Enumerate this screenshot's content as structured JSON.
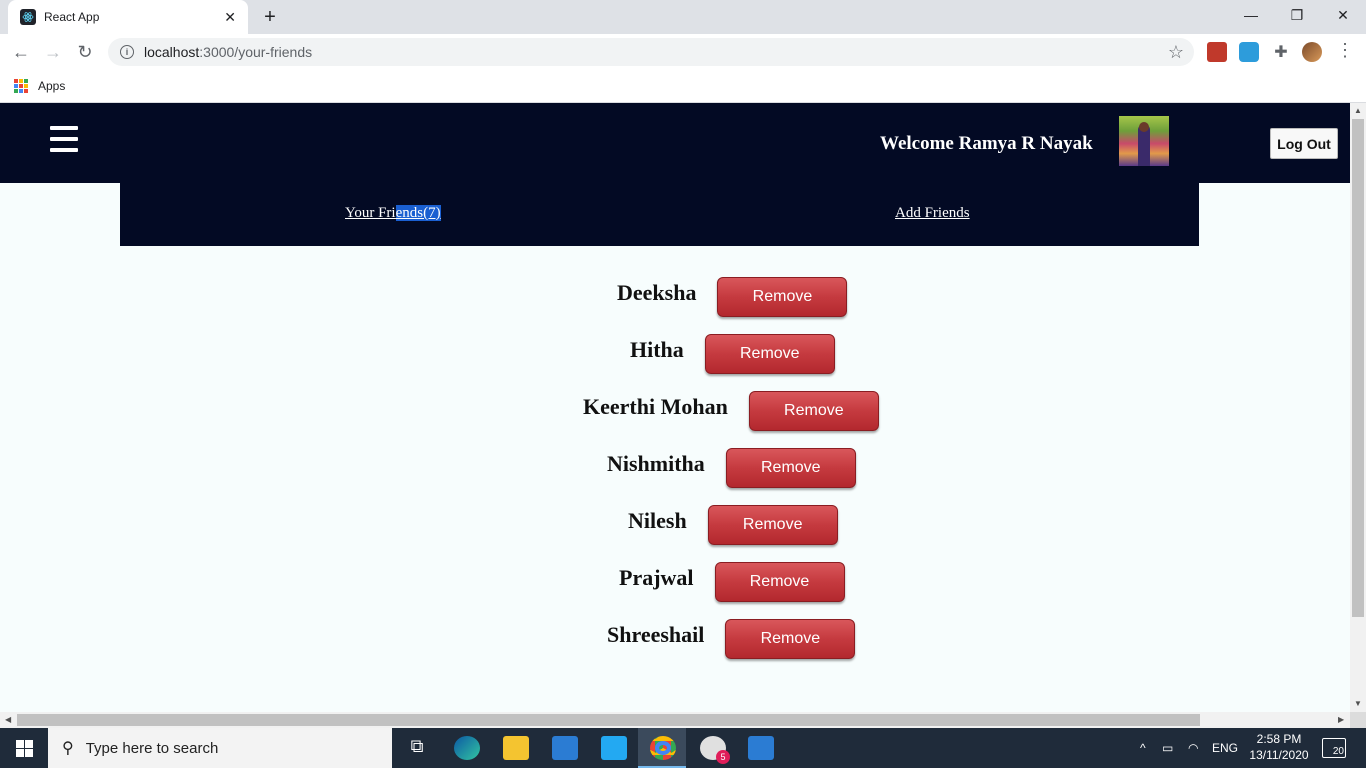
{
  "browser": {
    "tab_title": "React App",
    "tab_close": "✕",
    "new_tab": "+",
    "url_host": "localhost",
    "url_path": ":3000/your-friends",
    "bookmarks_apps": "Apps",
    "window_controls": {
      "minimize": "—",
      "restore": "❐",
      "close": "✕"
    }
  },
  "header": {
    "welcome": "Welcome Ramya R Nayak",
    "logout_label": "Log Out"
  },
  "subnav": {
    "your_friends_prefix": "Your Fri",
    "your_friends_selected": "ends(7)",
    "add_friends": "Add Friends"
  },
  "friends": [
    {
      "name": "Deeksha",
      "button": "Remove"
    },
    {
      "name": "Hitha",
      "button": "Remove"
    },
    {
      "name": "Keerthi Mohan",
      "button": "Remove"
    },
    {
      "name": "Nishmitha",
      "button": "Remove"
    },
    {
      "name": "Nilesh",
      "button": "Remove"
    },
    {
      "name": "Prajwal",
      "button": "Remove"
    },
    {
      "name": "Shreeshail",
      "button": "Remove"
    }
  ],
  "taskbar": {
    "search_placeholder": "Type here to search",
    "language": "ENG",
    "time": "2:58 PM",
    "date": "13/11/2020",
    "notification_count": "20",
    "slack_badge": "5"
  },
  "colors": {
    "header_bg": "#030a24",
    "remove_button": "#c53a3f",
    "page_bg": "#f7fdfd"
  }
}
